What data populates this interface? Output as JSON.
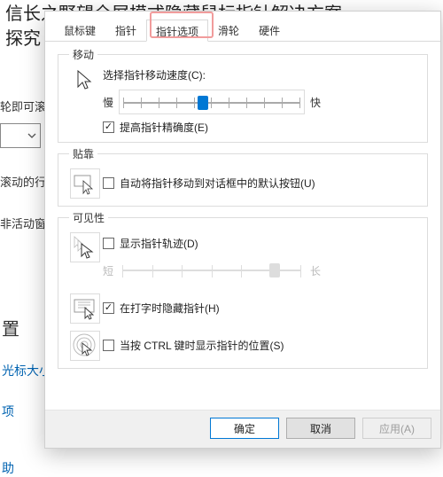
{
  "background": {
    "title": "信长之野望全屏模式隐藏鼠标指针解决方案\n探究",
    "left": {
      "scroll_text": "轮即可滚",
      "scroll_lines": "滚动的行",
      "inactive": "非活动窗口"
    },
    "lower": {
      "heading": "置",
      "link1": "光标大小",
      "link2": "项",
      "link3": "助"
    }
  },
  "dialog": {
    "tabs": [
      "鼠标键",
      "指针",
      "指针选项",
      "滑轮",
      "硬件"
    ],
    "active_tab_index": 2,
    "sections": {
      "motion": {
        "legend": "移动",
        "speed_label": "选择指针移动速度(C):",
        "slow": "慢",
        "fast": "快",
        "speed_ticks": 11,
        "speed_value_pct": 45,
        "precision_chk": {
          "checked": true,
          "label": "提高指针精确度(E)"
        }
      },
      "snap": {
        "legend": "贴靠",
        "chk": {
          "checked": false,
          "label": "自动将指针移动到对话框中的默认按钮(U)"
        }
      },
      "visibility": {
        "legend": "可见性",
        "trail": {
          "chk": {
            "checked": false,
            "label": "显示指针轨迹(D)"
          },
          "short": "短",
          "long": "长",
          "ticks": 7,
          "value_pct": 84
        },
        "hide_typing": {
          "checked": true,
          "label": "在打字时隐藏指针(H)"
        },
        "ctrl_locate": {
          "checked": false,
          "label": "当按 CTRL 键时显示指针的位置(S)"
        }
      }
    },
    "buttons": {
      "ok": "确定",
      "cancel": "取消",
      "apply": "应用(A)"
    }
  },
  "icons": {
    "cursor": "cursor-arrow",
    "snap": "snap-to-default",
    "trail": "pointer-trail",
    "hide": "hide-while-typing",
    "ctrl": "ctrl-locate"
  }
}
